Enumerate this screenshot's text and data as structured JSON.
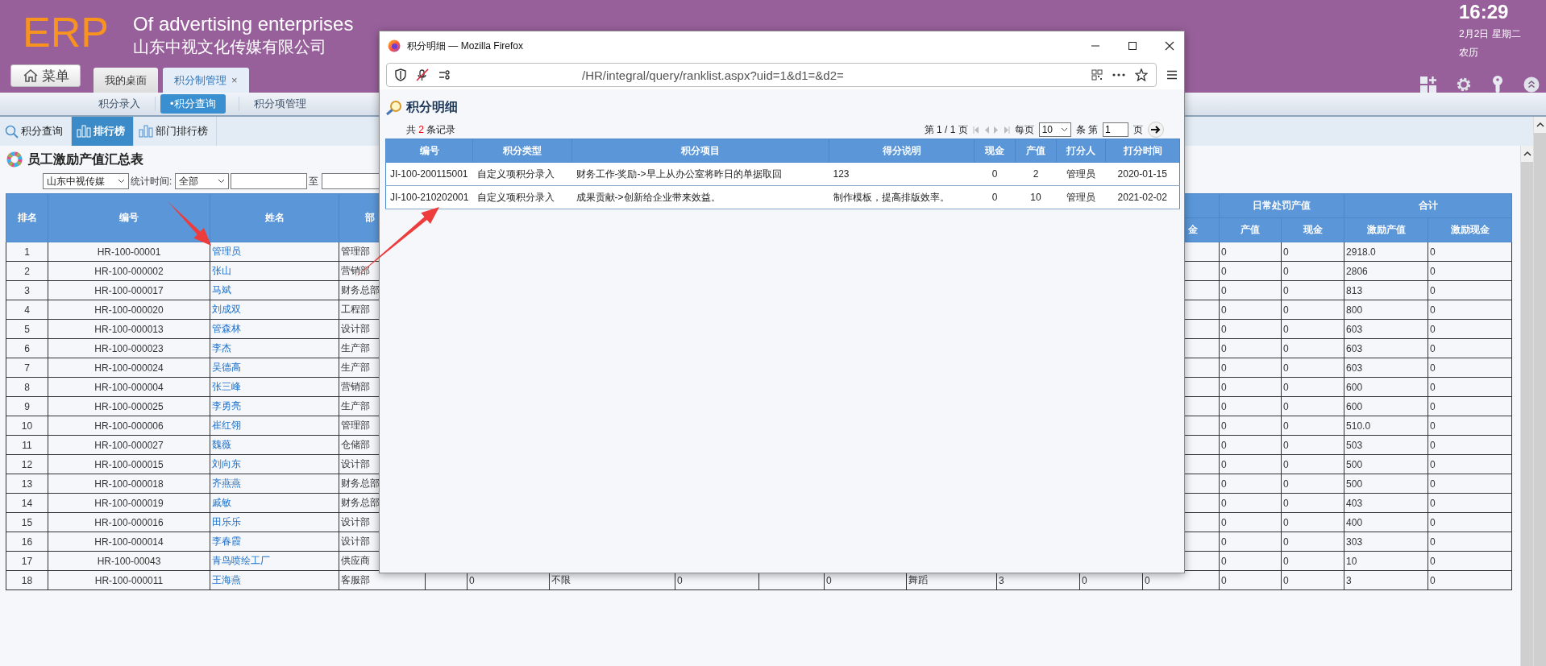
{
  "header": {
    "logo": "ERP",
    "tagline": "Of advertising enterprises",
    "company": "山东中视文化传媒有限公司",
    "menu_button": "菜单",
    "tabs": [
      {
        "label": "我的桌面",
        "selected": false
      },
      {
        "label": "积分制管理",
        "selected": true,
        "close": "×"
      }
    ],
    "clock": {
      "time": "16:29",
      "date": "2月2日 星期二",
      "lunar": "农历"
    }
  },
  "subnav": [
    {
      "label": "积分录入",
      "selected": false
    },
    {
      "label": "•积分查询",
      "selected": true
    },
    {
      "label": "积分项管理",
      "selected": false
    }
  ],
  "view_tabs": [
    {
      "label": "积分查询",
      "kind": "search",
      "selected": false
    },
    {
      "label": "排行榜",
      "kind": "chart",
      "selected": true
    },
    {
      "label": "部门排行榜",
      "kind": "chart",
      "selected": false
    }
  ],
  "report": {
    "title": "员工激励产值汇总表",
    "filters": {
      "company": "山东中视传媒",
      "period_label": "统计时间:",
      "period": "全部",
      "to_label": "至"
    },
    "table": {
      "columns": {
        "rank": "排名",
        "code": "编号",
        "name": "姓名",
        "column_4": "部",
        "column_14": "金",
        "groups": [
          {
            "label": "日常处罚产值",
            "columns": [
              "产值",
              "现金"
            ]
          },
          {
            "label": "合计",
            "columns": [
              "激励产值",
              "激励现金"
            ]
          }
        ]
      },
      "rows": [
        {
          "rank": "1",
          "code": "HR-100-00001",
          "name": "管理员",
          "department": "管理部",
          "values": [
            "0",
            "0",
            "2918.0",
            "0"
          ]
        },
        {
          "rank": "2",
          "code": "HR-100-000002",
          "name": "张山",
          "department": "营销部",
          "values": [
            "0",
            "0",
            "2806",
            "0"
          ]
        },
        {
          "rank": "3",
          "code": "HR-100-000017",
          "name": "马斌",
          "department": "财务总部",
          "values": [
            "0",
            "0",
            "813",
            "0"
          ]
        },
        {
          "rank": "4",
          "code": "HR-100-000020",
          "name": "刘成双",
          "department": "工程部",
          "values": [
            "0",
            "0",
            "800",
            "0"
          ]
        },
        {
          "rank": "5",
          "code": "HR-100-000013",
          "name": "管森林",
          "department": "设计部",
          "values": [
            "0",
            "0",
            "603",
            "0"
          ]
        },
        {
          "rank": "6",
          "code": "HR-100-000023",
          "name": "李杰",
          "department": "生产部",
          "values": [
            "0",
            "0",
            "603",
            "0"
          ]
        },
        {
          "rank": "7",
          "code": "HR-100-000024",
          "name": "吴德高",
          "department": "生产部",
          "values": [
            "0",
            "0",
            "603",
            "0"
          ]
        },
        {
          "rank": "8",
          "code": "HR-100-000004",
          "name": "张三峰",
          "department": "营销部",
          "values": [
            "0",
            "0",
            "600",
            "0"
          ]
        },
        {
          "rank": "9",
          "code": "HR-100-000025",
          "name": "李勇亮",
          "department": "生产部",
          "values": [
            "0",
            "0",
            "600",
            "0"
          ]
        },
        {
          "rank": "10",
          "code": "HR-100-000006",
          "name": "崔红翎",
          "department": "管理部",
          "values": [
            "0",
            "0",
            "510.0",
            "0"
          ]
        },
        {
          "rank": "11",
          "code": "HR-100-000027",
          "name": "魏薇",
          "department": "仓储部",
          "values": [
            "0",
            "0",
            "503",
            "0"
          ]
        },
        {
          "rank": "12",
          "code": "HR-100-000015",
          "name": "刘向东",
          "department": "设计部",
          "values": [
            "0",
            "0",
            "500",
            "0"
          ]
        },
        {
          "rank": "13",
          "code": "HR-100-000018",
          "name": "齐燕燕",
          "department": "财务总部",
          "values": [
            "0",
            "0",
            "500",
            "0"
          ]
        },
        {
          "rank": "14",
          "code": "HR-100-000019",
          "name": "戚敏",
          "department": "财务总部",
          "values": [
            "0",
            "0",
            "403",
            "0"
          ]
        },
        {
          "rank": "15",
          "code": "HR-100-000016",
          "name": "田乐乐",
          "department": "设计部",
          "values": [
            "0",
            "0",
            "400",
            "0"
          ]
        },
        {
          "rank": "16",
          "code": "HR-100-000014",
          "name": "李春霞",
          "department": "设计部",
          "values": [
            "0",
            "0",
            "303",
            "0"
          ]
        },
        {
          "rank": "17",
          "code": "HR-100-00043",
          "name": "青鸟喷绘工厂",
          "department": "供应商",
          "values": [
            "0",
            "0",
            "10",
            "0"
          ]
        },
        {
          "rank": "18",
          "code": "HR-100-000011",
          "name": "王海燕",
          "department": "客服部",
          "middle": [
            {
              "kind": "empty"
            },
            {
              "kind": "text",
              "text": "0"
            },
            {
              "kind": "text",
              "text": "不限"
            },
            {
              "kind": "text",
              "text": "0"
            },
            {
              "kind": "empty"
            },
            {
              "kind": "text",
              "text": "0"
            },
            {
              "kind": "text",
              "text": "舞蹈"
            },
            {
              "kind": "text",
              "text": "3"
            },
            {
              "kind": "text",
              "text": "0"
            },
            {
              "kind": "text",
              "text": "0"
            }
          ],
          "values": [
            "0",
            "0",
            "3",
            "0"
          ]
        }
      ]
    }
  },
  "popup": {
    "window_title": "积分明细 — Mozilla Firefox",
    "url": "/HR/integral/query/ranklist.aspx?uid=1&d1=&d2=",
    "title": "积分明细",
    "summary": {
      "prefix": "共",
      "count": "2",
      "suffix": "条记录"
    },
    "pager": {
      "page_info": "第 1 / 1 页",
      "per_page_label": "每页",
      "per_page": "10",
      "page_label": "条 第",
      "page": "1",
      "page_suffix": "页"
    },
    "table": {
      "columns": [
        "编号",
        "积分类型",
        "积分项目",
        "得分说明",
        "现金",
        "产值",
        "打分人",
        "打分时间"
      ],
      "rows": [
        [
          "JI-100-200115001",
          "自定义项积分录入",
          "财务工作-奖励->早上从办公室将昨日的单据取回",
          "123",
          "0",
          "2",
          "管理员",
          "2020-01-15"
        ],
        [
          "JI-100-210202001",
          "自定义项积分录入",
          "成果贡献->创新给企业带来效益。",
          "制作模板，提高排版效率。",
          "0",
          "10",
          "管理员",
          "2021-02-02"
        ]
      ]
    }
  }
}
